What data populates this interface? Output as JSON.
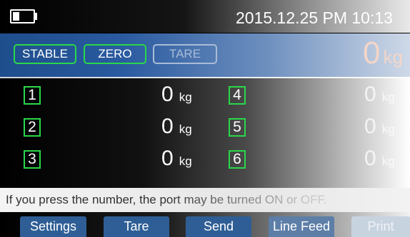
{
  "header": {
    "datetime": "2015.12.25 PM 10:13",
    "battery_icon": "battery-icon"
  },
  "status": {
    "stable_label": "STABLE",
    "zero_label": "ZERO",
    "tare_label": "TARE",
    "total_value": "0",
    "total_unit": "kg",
    "active_color": "#29d84a"
  },
  "ports": [
    {
      "number": "1",
      "value": "0",
      "unit": "kg"
    },
    {
      "number": "2",
      "value": "0",
      "unit": "kg"
    },
    {
      "number": "3",
      "value": "0",
      "unit": "kg"
    },
    {
      "number": "4",
      "value": "0",
      "unit": "kg"
    },
    {
      "number": "5",
      "value": "0",
      "unit": "kg"
    },
    {
      "number": "6",
      "value": "0",
      "unit": "kg"
    }
  ],
  "hint": "If you press the number, the port may be turned ON or OFF.",
  "function_keys": [
    "Settings",
    "Tare",
    "Send",
    "Line Feed",
    "Print"
  ]
}
